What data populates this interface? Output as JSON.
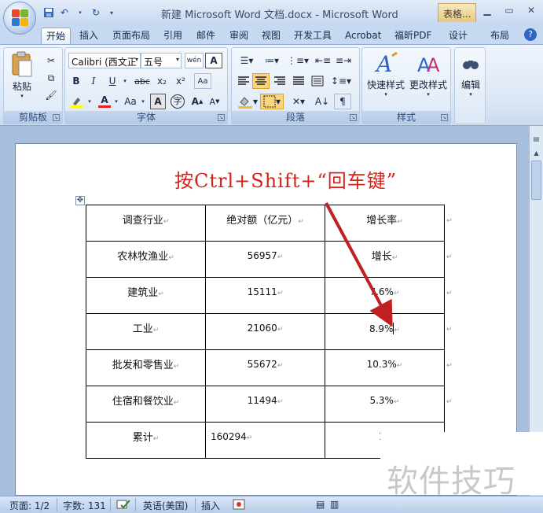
{
  "window": {
    "title": "新建 Microsoft Word 文档.docx - Microsoft Word",
    "context_tab": "表格...",
    "min_icon": "minimize-icon",
    "max_icon": "maximize-icon",
    "close_icon": "close-icon"
  },
  "ribbon_tabs": [
    "开始",
    "插入",
    "页面布局",
    "引用",
    "邮件",
    "审阅",
    "视图",
    "开发工具",
    "Acrobat",
    "福昕PDF",
    "设计",
    "布局"
  ],
  "active_tab": "开始",
  "ribbon": {
    "clipboard": {
      "label": "剪贴板",
      "paste_label": "粘贴"
    },
    "font": {
      "label": "字体",
      "font_name": "Calibri (西文正",
      "font_size": "五号",
      "wen_label": "wén",
      "a_label": "A",
      "bold": "B",
      "italic": "I",
      "underline": "U",
      "strike": "abc",
      "sub": "x₂",
      "sup": "x²",
      "clear": "Aa",
      "grow": "A",
      "shrink": "A",
      "char_border": "A",
      "char_circle": "字"
    },
    "paragraph": {
      "label": "段落"
    },
    "styles": {
      "label": "样式",
      "quick_styles": "快速样式",
      "change_styles": "更改样式"
    },
    "editing": {
      "label": "编辑"
    }
  },
  "document": {
    "annotation": "按Ctrl+Shift+“回车键”",
    "table": {
      "headers": [
        "调查行业",
        "绝对额（亿元）",
        "增长率"
      ],
      "rows": [
        [
          "农林牧渔业",
          "56957",
          "增长"
        ],
        [
          "建筑业",
          "15111",
          "7.6%"
        ],
        [
          "工业",
          "21060",
          "8.9%"
        ],
        [
          "批发和零售业",
          "55672",
          "10.3%"
        ],
        [
          "住宿和餐饮业",
          "11494",
          "5.3%"
        ],
        [
          "累计",
          "160294",
          "16"
        ]
      ]
    }
  },
  "watermark": "软件技巧",
  "status": {
    "page": "页面: 1/2",
    "words": "字数: 131",
    "language": "英语(美国)",
    "mode": "插入"
  },
  "colors": {
    "annotation": "#d4231b",
    "arrow": "#c0201f",
    "ribbon_bg": "#dbe7f6"
  }
}
